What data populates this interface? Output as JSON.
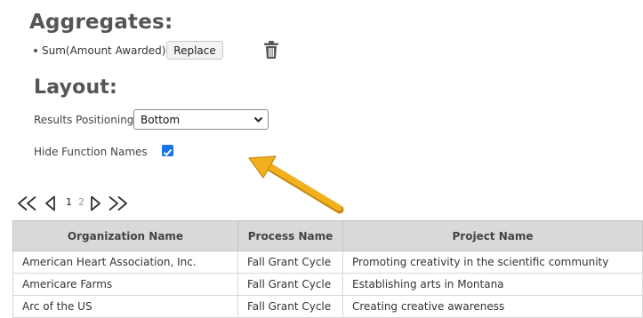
{
  "aggregates": {
    "heading": "Aggregates:",
    "item_label": "Sum(Amount Awarded)",
    "replace_label": "Replace",
    "delete_icon": "trash-icon"
  },
  "layout": {
    "heading": "Layout:",
    "results_positioning_label": "Results Positioning",
    "results_positioning_value": "Bottom",
    "hide_function_names_label": "Hide Function Names",
    "hide_function_names_checked": true
  },
  "annotation": {
    "arrow_color": "#f2b01e"
  },
  "pager": {
    "first_icon": "first-page-icon",
    "prev_icon": "prev-page-icon",
    "current_page": "1",
    "next_page_number": "2",
    "next_icon": "next-page-icon",
    "last_icon": "last-page-icon"
  },
  "table": {
    "headers": [
      "Organization Name",
      "Process Name",
      "Project Name"
    ],
    "rows": [
      [
        "American Heart Association, Inc.",
        "Fall Grant Cycle",
        "Promoting creativity in the scientific community"
      ],
      [
        "Americare Farms",
        "Fall Grant Cycle",
        "Establishing arts in Montana"
      ],
      [
        "Arc of the US",
        "Fall Grant Cycle",
        "Creating creative awareness"
      ]
    ]
  },
  "colors": {
    "accent": "#1a73e8",
    "heading": "#555555",
    "table_header_bg": "#d9d9d9"
  }
}
